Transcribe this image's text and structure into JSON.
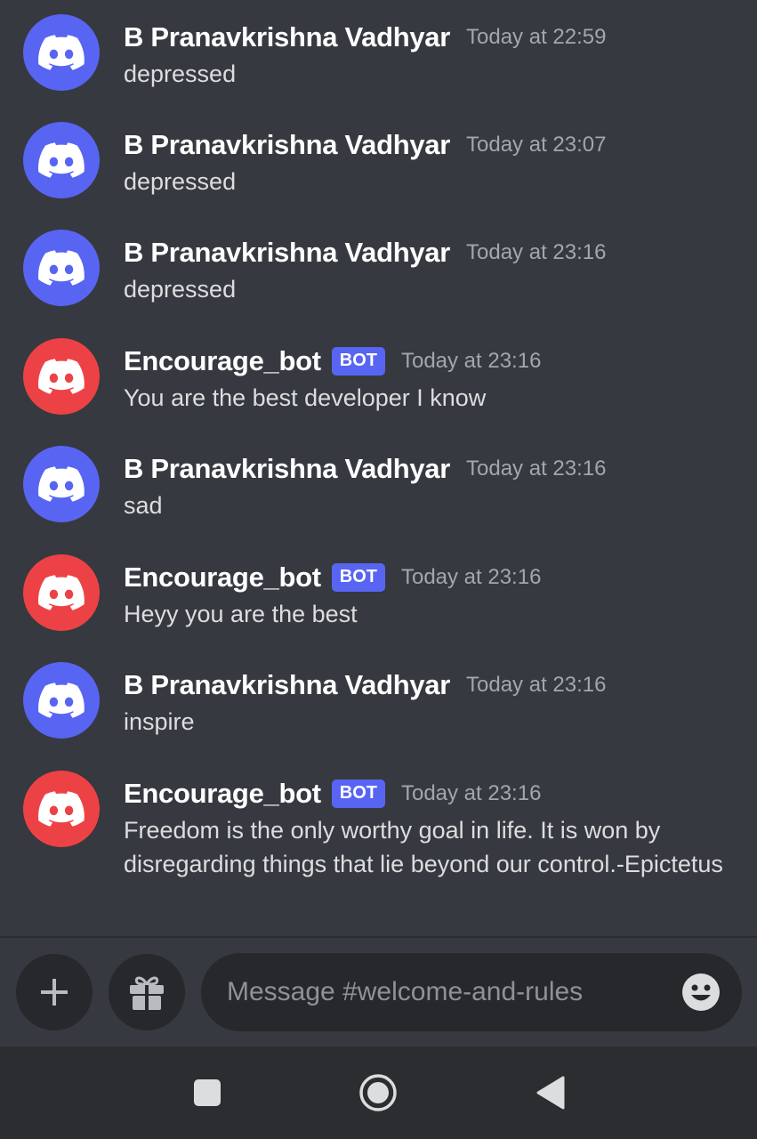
{
  "colors": {
    "background": "#36393f",
    "user_avatar": "#5865f2",
    "bot_avatar": "#ed4245",
    "bot_tag": "#5865f2"
  },
  "messages": [
    {
      "author": "B Pranavkrishna Vadhyar",
      "is_bot": false,
      "bot_tag": "",
      "timestamp": "Today at 22:59",
      "content": "depressed",
      "avatar_icon": "discord-logo-icon"
    },
    {
      "author": "B Pranavkrishna Vadhyar",
      "is_bot": false,
      "bot_tag": "",
      "timestamp": "Today at 23:07",
      "content": "depressed",
      "avatar_icon": "discord-logo-icon"
    },
    {
      "author": "B Pranavkrishna Vadhyar",
      "is_bot": false,
      "bot_tag": "",
      "timestamp": "Today at 23:16",
      "content": "depressed",
      "avatar_icon": "discord-logo-icon"
    },
    {
      "author": "Encourage_bot",
      "is_bot": true,
      "bot_tag": "BOT",
      "timestamp": "Today at 23:16",
      "content": "You are the best developer I know",
      "avatar_icon": "discord-logo-icon"
    },
    {
      "author": "B Pranavkrishna Vadhyar",
      "is_bot": false,
      "bot_tag": "",
      "timestamp": "Today at 23:16",
      "content": "sad",
      "avatar_icon": "discord-logo-icon"
    },
    {
      "author": "Encourage_bot",
      "is_bot": true,
      "bot_tag": "BOT",
      "timestamp": "Today at 23:16",
      "content": "Heyy you are the best",
      "avatar_icon": "discord-logo-icon"
    },
    {
      "author": "B Pranavkrishna Vadhyar",
      "is_bot": false,
      "bot_tag": "",
      "timestamp": "Today at 23:16",
      "content": "inspire",
      "avatar_icon": "discord-logo-icon"
    },
    {
      "author": "Encourage_bot",
      "is_bot": true,
      "bot_tag": "BOT",
      "timestamp": "Today at 23:16",
      "content": "Freedom is the only worthy goal in life. It is won by disregarding things that lie beyond our control.-Epictetus",
      "avatar_icon": "discord-logo-icon"
    }
  ],
  "composer": {
    "add_icon": "plus-icon",
    "gift_icon": "gift-icon",
    "placeholder": "Message #welcome-and-rules",
    "emoji_icon": "emoji-smile-icon"
  },
  "navbar": {
    "items": [
      "recent-apps-icon",
      "home-icon",
      "back-icon"
    ]
  }
}
